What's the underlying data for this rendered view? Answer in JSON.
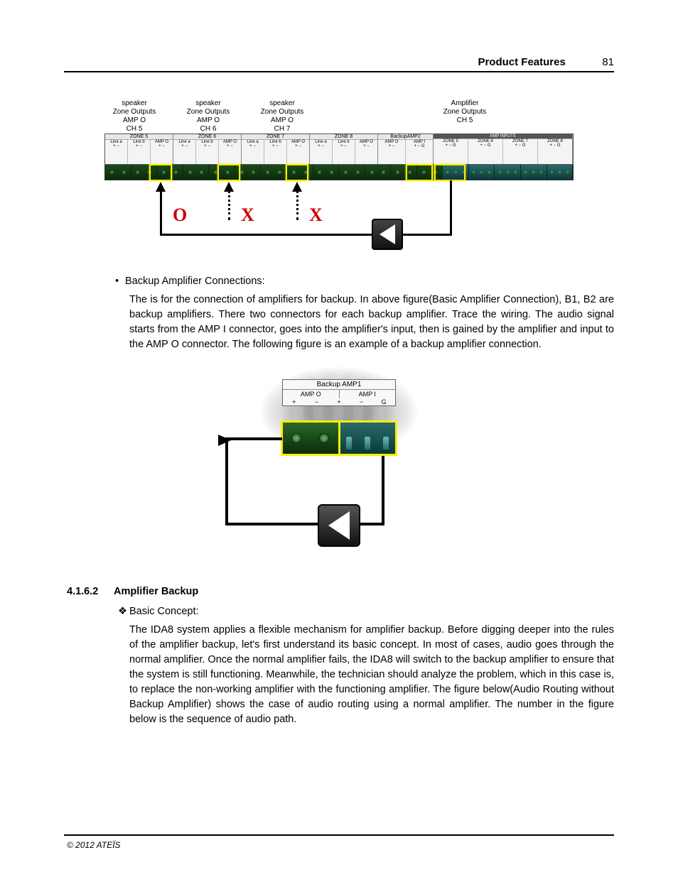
{
  "header": {
    "title": "Product Features",
    "page": "81"
  },
  "figure1": {
    "top_labels": [
      {
        "l1": "speaker",
        "l2": "Zone Outputs",
        "l3": "AMP O",
        "l4": "CH 5"
      },
      {
        "l1": "speaker",
        "l2": "Zone Outputs",
        "l3": "AMP O",
        "l4": "CH 6"
      },
      {
        "l1": "speaker",
        "l2": "Zone Outputs",
        "l3": "AMP O",
        "l4": "CH 7"
      },
      {
        "l1": "Amplifier",
        "l2": "Zone Outputs",
        "l3": "",
        "l4": "CH 5"
      }
    ],
    "zones": [
      {
        "title": "ZONE 5",
        "subs": [
          {
            "n": "Line a",
            "pm": "+ −"
          },
          {
            "n": "Line b",
            "pm": "+ −"
          },
          {
            "n": "AMP O",
            "pm": "+ −"
          }
        ]
      },
      {
        "title": "ZONE 6",
        "subs": [
          {
            "n": "Line a",
            "pm": "+ −"
          },
          {
            "n": "Line b",
            "pm": "+ −"
          },
          {
            "n": "AMP O",
            "pm": "+ −"
          }
        ]
      },
      {
        "title": "ZONE 7",
        "subs": [
          {
            "n": "Line a",
            "pm": "+ −"
          },
          {
            "n": "Line b",
            "pm": "+ −"
          },
          {
            "n": "AMP O",
            "pm": "+ −"
          }
        ]
      },
      {
        "title": "ZONE 8",
        "subs": [
          {
            "n": "Line a",
            "pm": "+ −"
          },
          {
            "n": "Line b",
            "pm": "+ −"
          },
          {
            "n": "AMP O",
            "pm": "+ −"
          }
        ]
      },
      {
        "title": "BackupAMP2",
        "subs": [
          {
            "n": "AMP O",
            "pm": "+ −"
          },
          {
            "n": "AMP I",
            "pm": "+ − G"
          }
        ]
      }
    ],
    "amp_inputs": {
      "label": "AMP INPUTS",
      "subs": [
        {
          "n": "ZONE 5",
          "pm": "+ − G"
        },
        {
          "n": "ZONE 6",
          "pm": "+ − G"
        },
        {
          "n": "ZONE 7",
          "pm": "+ − G"
        },
        {
          "n": "ZONE 8",
          "pm": "+ − G"
        }
      ]
    },
    "markers": {
      "o": "O",
      "x1": "X",
      "x2": "X"
    }
  },
  "bullet1": {
    "label": "Backup Amplifier Connections:"
  },
  "para1": "The is for the connection of amplifiers for backup. In above figure(Basic Amplifier Connection), B1, B2 are backup amplifiers. There two connectors for each backup amplifier. Trace the wiring. The audio signal starts from the AMP I connector, goes into the amplifier's input, then is gained by the amplifier and input to the AMP O connector. The following figure is an example of a backup amplifier connection.",
  "figure2": {
    "header": "Backup AMP1",
    "left": {
      "name": "AMP O",
      "pm": [
        "+",
        "−"
      ]
    },
    "right": {
      "name": "AMP I",
      "pm": [
        "+",
        "−",
        "G"
      ]
    }
  },
  "section": {
    "num": "4.1.6.2",
    "title": "Amplifier Backup"
  },
  "diamond1": {
    "label": "Basic Concept:"
  },
  "para2": "The IDA8 system applies a flexible mechanism for amplifier backup. Before digging deeper into the rules of the amplifier backup, let's first understand its basic concept. In most of cases, audio goes through the normal amplifier. Once the normal amplifier fails, the IDA8 will switch to the backup amplifier to ensure that the system is still functioning. Meanwhile, the technician should analyze the problem, which in this case is, to replace the non-working amplifier with the functioning amplifier. The figure below(Audio Routing without Backup Amplifier) shows the case of audio routing using a normal amplifier. The number in the figure below is the sequence of audio path.",
  "footer": "© 2012 ATEÏS"
}
